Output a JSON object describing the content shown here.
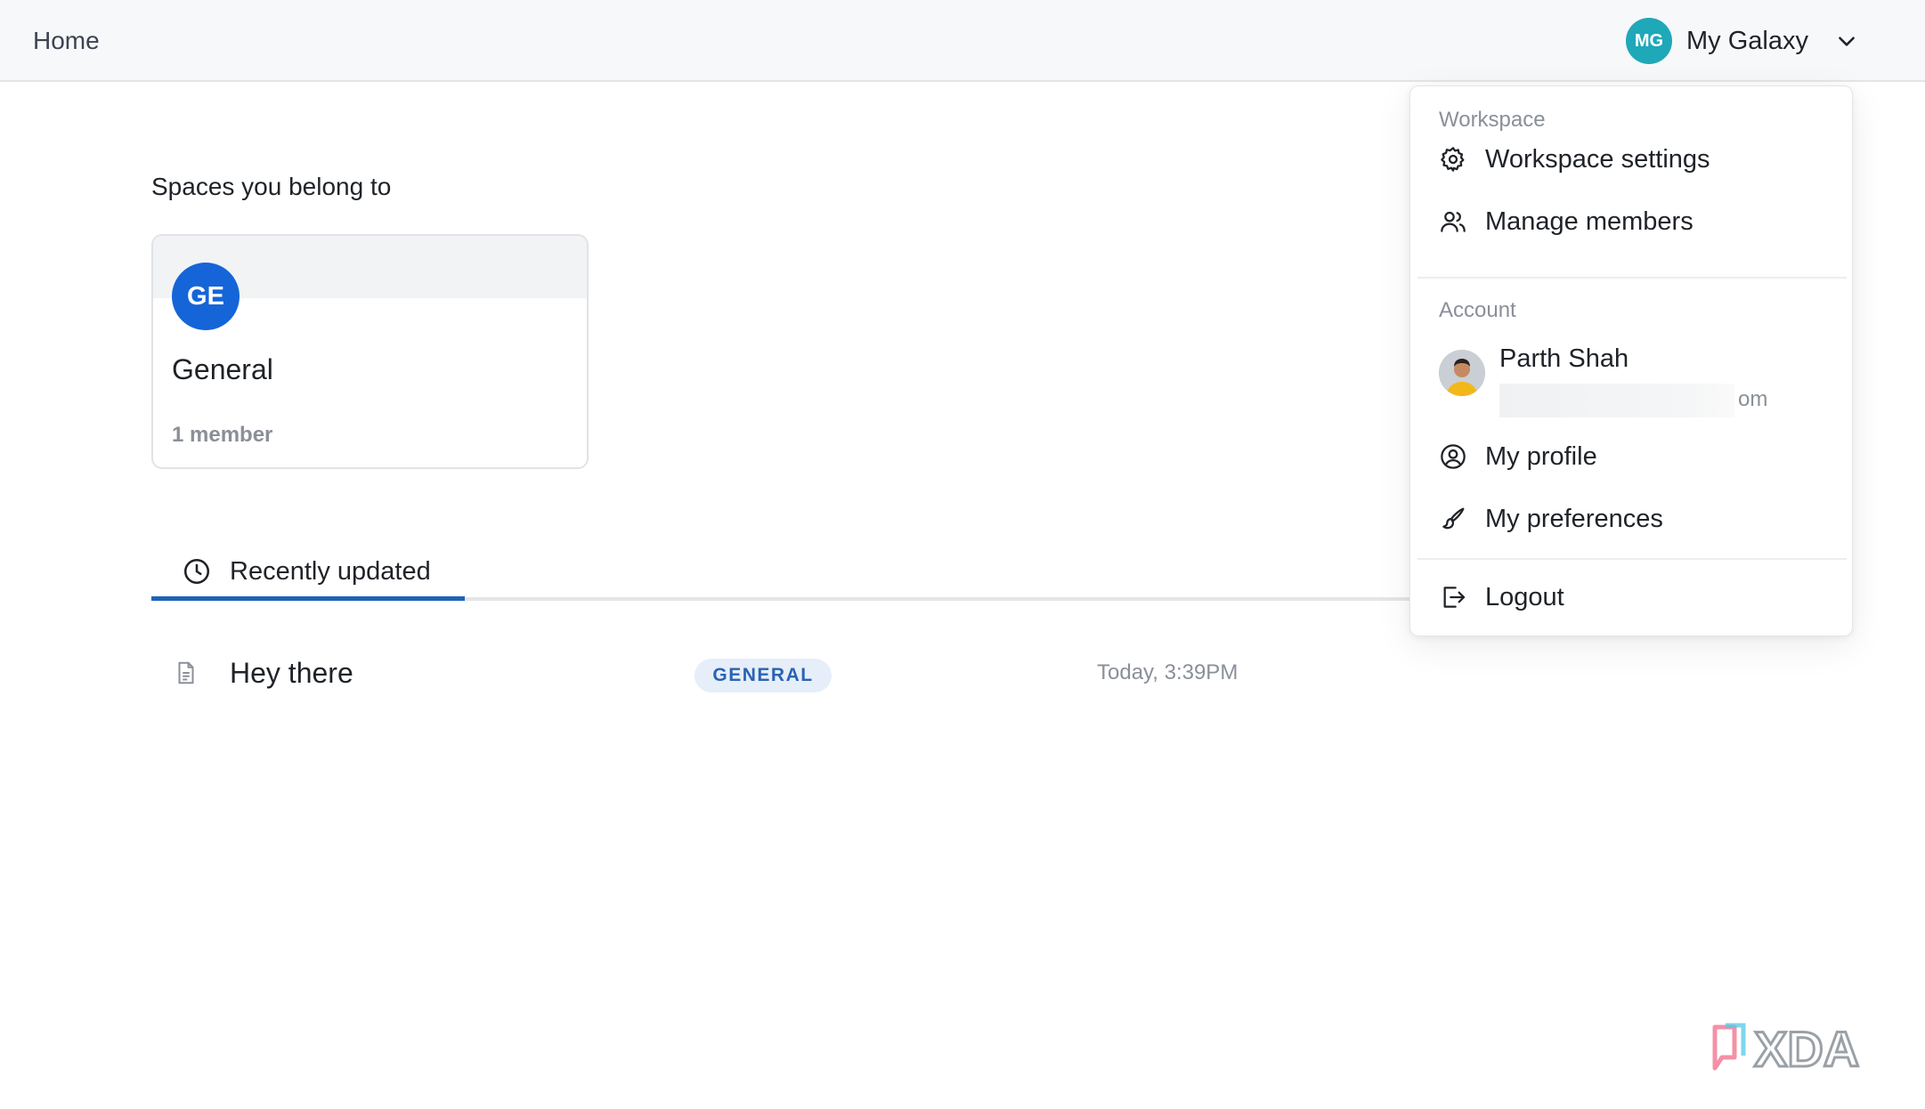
{
  "header": {
    "home_label": "Home",
    "workspace_initials": "MG",
    "workspace_name": "My Galaxy",
    "avatar_color": "#1fa8b8"
  },
  "spaces": {
    "section_title": "Spaces you belong to",
    "items": [
      {
        "initials": "GE",
        "name": "General",
        "members": "1 member",
        "avatar_color": "#1565d8"
      }
    ]
  },
  "tabs": [
    {
      "label": "Recently updated",
      "icon": "clock-icon",
      "active": true
    }
  ],
  "documents": [
    {
      "title": "Hey there",
      "space_badge": "GENERAL",
      "updated": "Today, 3:39PM",
      "icon": "document-icon"
    }
  ],
  "dropdown": {
    "workspace_group": "Workspace",
    "workspace_settings": "Workspace settings",
    "manage_members": "Manage members",
    "account_group": "Account",
    "user_name": "Parth Shah",
    "user_email_visible": "om",
    "my_profile": "My profile",
    "my_preferences": "My preferences",
    "logout": "Logout"
  },
  "watermark": {
    "text": "XDA"
  },
  "colors": {
    "accent": "#1f63b8",
    "badge_bg": "#e6eef9",
    "badge_text": "#2a63b3",
    "muted_text": "#8a8f98"
  }
}
